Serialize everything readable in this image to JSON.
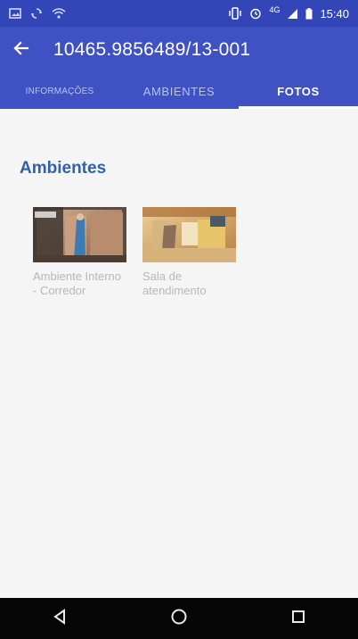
{
  "status_bar": {
    "time": "15:40",
    "network": "4G",
    "icons": [
      "image-notification-icon",
      "sync-icon",
      "wifi-icon",
      "vibrate-icon",
      "alarm-icon",
      "signal-icon",
      "battery-icon"
    ]
  },
  "toolbar": {
    "title": "10465.9856489/13-001",
    "back_icon": "back-arrow-icon"
  },
  "tabs": [
    {
      "label": "Informações",
      "active": false
    },
    {
      "label": "Ambientes",
      "active": false
    },
    {
      "label": "Fotos",
      "active": true
    }
  ],
  "content": {
    "section_title": "Ambientes",
    "photos": [
      {
        "caption": "Ambiente Interno - Corredor"
      },
      {
        "caption": "Sala de atendimento"
      }
    ]
  },
  "nav_bar": {
    "icons": [
      "back-triangle-icon",
      "home-circle-icon",
      "recents-square-icon"
    ]
  },
  "colors": {
    "status_bar": "#3346b7",
    "app_bar": "#3f51c3",
    "accent_title": "#2f62a9",
    "caption": "#b7b7b7"
  }
}
